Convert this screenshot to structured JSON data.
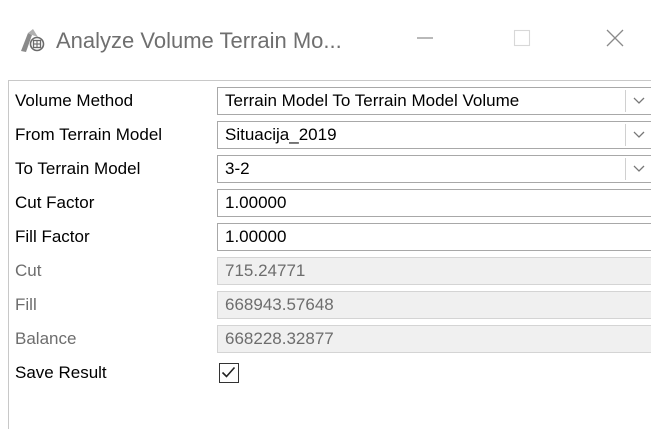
{
  "window": {
    "title": "Analyze Volume Terrain Mo...",
    "icon": "analyze-volume-terrain-icon",
    "controls": [
      "minimize-icon",
      "maximize-icon",
      "close-icon"
    ]
  },
  "fields": {
    "volume_method": {
      "label": "Volume Method",
      "value": "Terrain Model To Terrain Model Volume"
    },
    "from_terrain_model": {
      "label": "From Terrain Model",
      "value": "Situacija_2019"
    },
    "to_terrain_model": {
      "label": "To Terrain Model",
      "value": "3-2"
    },
    "cut_factor": {
      "label": "Cut Factor",
      "value": "1.00000"
    },
    "fill_factor": {
      "label": "Fill Factor",
      "value": "1.00000"
    },
    "cut": {
      "label": "Cut",
      "value": "715.24771"
    },
    "fill": {
      "label": "Fill",
      "value": "668943.57648"
    },
    "balance": {
      "label": "Balance",
      "value": "668228.32877"
    },
    "save_result": {
      "label": "Save Result",
      "checked": true
    }
  },
  "colors": {
    "title_text": "#6f6f6f",
    "disabled_text": "#6d6d6d",
    "readonly_bg": "#f0f0f0"
  }
}
